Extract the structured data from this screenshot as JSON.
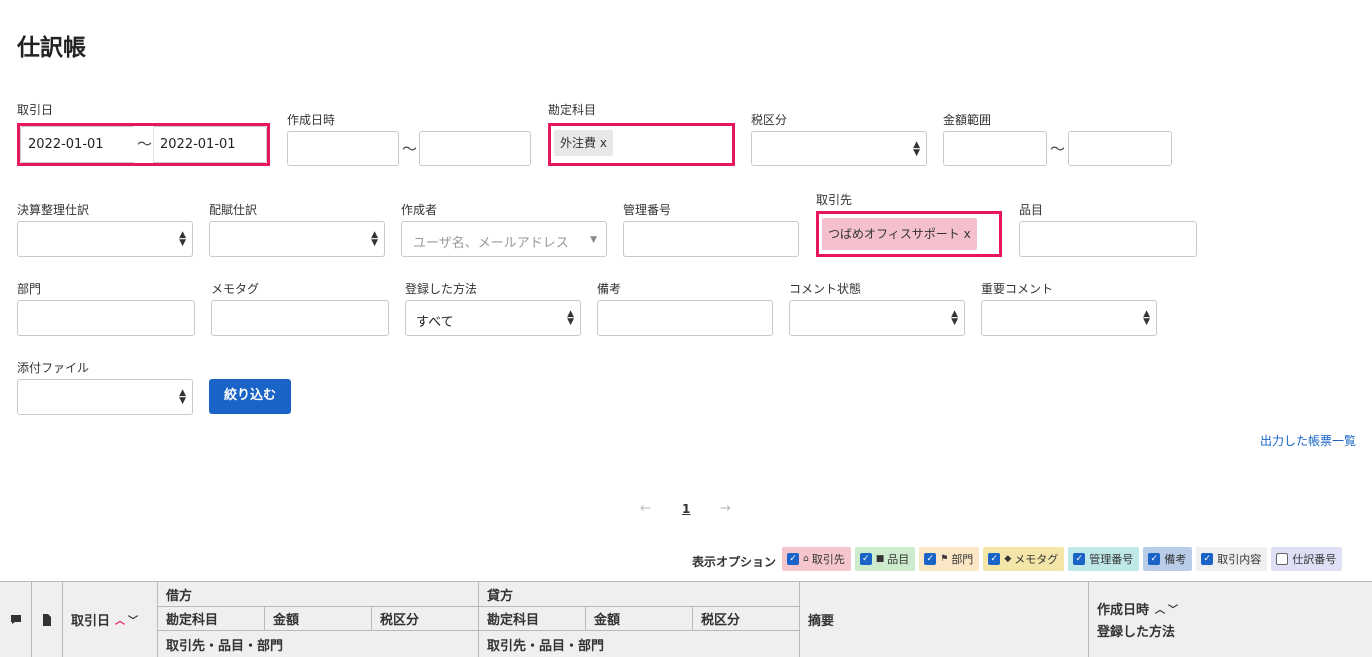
{
  "page": {
    "title": "仕訳帳"
  },
  "filters": {
    "transaction_date": {
      "label": "取引日",
      "from": "2022-01-01",
      "to": "2022-01-01",
      "separator": "〜"
    },
    "created_at": {
      "label": "作成日時",
      "from": "",
      "to": "",
      "separator": "〜"
    },
    "account": {
      "label": "勘定科目",
      "chip": "外注費 x"
    },
    "tax_category": {
      "label": "税区分",
      "value": ""
    },
    "amount_range": {
      "label": "金額範囲",
      "from": "",
      "to": "",
      "separator": "〜"
    },
    "closing_entry": {
      "label": "決算整理仕訳",
      "value": ""
    },
    "allocation_entry": {
      "label": "配賦仕訳",
      "value": ""
    },
    "creator": {
      "label": "作成者",
      "placeholder": "ユーザ名、メールアドレス"
    },
    "control_number": {
      "label": "管理番号",
      "value": ""
    },
    "partner": {
      "label": "取引先",
      "chip": "つばめオフィスサポート x"
    },
    "item": {
      "label": "品目",
      "value": ""
    },
    "department": {
      "label": "部門",
      "value": ""
    },
    "memo_tag": {
      "label": "メモタグ",
      "value": ""
    },
    "registration_method": {
      "label": "登録した方法",
      "value": "すべて"
    },
    "remarks": {
      "label": "備考",
      "value": ""
    },
    "comment_status": {
      "label": "コメント状態",
      "value": ""
    },
    "important_comment": {
      "label": "重要コメント",
      "value": ""
    },
    "attachment": {
      "label": "添付ファイル",
      "value": ""
    },
    "submit_label": "絞り込む"
  },
  "output_link": "出力した帳票一覧",
  "pagination": {
    "prev": "←",
    "current": "1",
    "next": "→"
  },
  "display_options": {
    "label": "表示オプション",
    "options": [
      {
        "label": "取引先",
        "icon": "home-icon",
        "checked": true,
        "color": "#f5c6cc"
      },
      {
        "label": "品目",
        "icon": "briefcase-icon",
        "checked": true,
        "color": "#cdeccd"
      },
      {
        "label": "部門",
        "icon": "flag-icon",
        "checked": true,
        "color": "#fbe7c6"
      },
      {
        "label": "メモタグ",
        "icon": "tag-icon",
        "checked": true,
        "color": "#f4e6a8"
      },
      {
        "label": "管理番号",
        "icon": "",
        "checked": true,
        "color": "#bfe8e8"
      },
      {
        "label": "備考",
        "icon": "",
        "checked": true,
        "color": "#b9cce8"
      },
      {
        "label": "取引内容",
        "icon": "",
        "checked": true,
        "color": "#efefef"
      },
      {
        "label": "仕訳番号",
        "icon": "",
        "checked": false,
        "color": "#dfdff5"
      }
    ]
  },
  "table": {
    "comment_icon": "comment-icon",
    "file_icon": "file-icon",
    "date_header": "取引日",
    "date_sort_up": "︿",
    "date_sort_down": "﹀",
    "debit": {
      "title": "借方",
      "account": "勘定科目",
      "amount": "金額",
      "tax": "税区分",
      "sub": "取引先・品目・部門"
    },
    "credit": {
      "title": "貸方",
      "account": "勘定科目",
      "amount": "金額",
      "tax": "税区分",
      "sub": "取引先・品目・部門"
    },
    "description": "摘要",
    "created_at": "作成日時",
    "created_sort_up": "︿",
    "created_sort_down": "﹀",
    "registration_method": "登録した方法"
  }
}
